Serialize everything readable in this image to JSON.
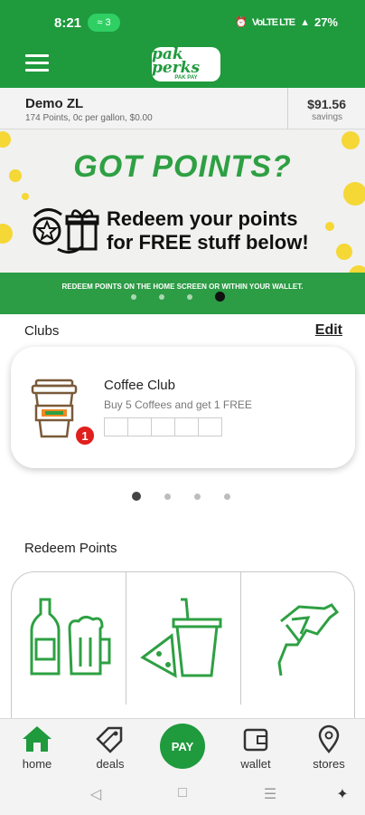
{
  "status_bar": {
    "time": "8:21",
    "notification_count": "3",
    "network": "VoLTE LTE",
    "battery": "27%"
  },
  "header": {
    "logo_main": "pak perks",
    "logo_sub": "PAK PAY"
  },
  "account": {
    "name": "Demo ZL",
    "details": "174 Points, 0c per gallon, $0.00",
    "savings_amount": "$91.56",
    "savings_label": "savings"
  },
  "banner": {
    "headline": "GOT POINTS?",
    "line1": "Redeem your points",
    "line2": "for FREE stuff below!",
    "strip_text": "REDEEM POINTS ON THE HOME SCREEN OR WITHIN YOUR WALLET.",
    "page_count": 4,
    "active_page": 4
  },
  "clubs": {
    "title": "Clubs",
    "edit_label": "Edit",
    "card": {
      "title": "Coffee Club",
      "description": "Buy 5 Coffees and get 1 FREE",
      "badge_count": "1",
      "punches_total": 5,
      "punches_filled": 0
    },
    "page_count": 4,
    "active_page": 1
  },
  "redeem": {
    "title": "Redeem Points",
    "categories": [
      {
        "icon": "drinks-icon"
      },
      {
        "icon": "food-icon"
      },
      {
        "icon": "fuel-icon"
      }
    ]
  },
  "bottom_nav": {
    "home": "home",
    "deals": "deals",
    "pay": "PAY",
    "wallet": "wallet",
    "stores": "stores"
  },
  "colors": {
    "brand_green": "#1f9a3d",
    "badge_red": "#e0201d",
    "coin_yellow": "#f5d736"
  }
}
